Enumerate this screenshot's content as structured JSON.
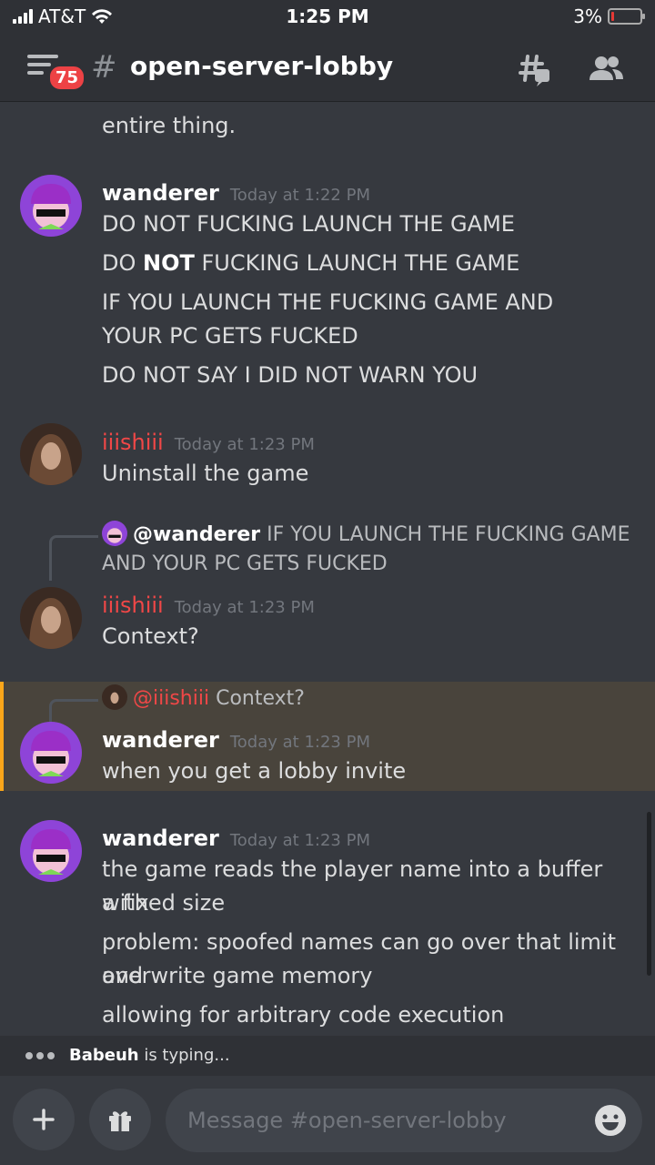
{
  "status": {
    "carrier": "AT&T",
    "time": "1:25 PM",
    "battery": "3%"
  },
  "header": {
    "badge": "75",
    "hash": "#",
    "channel": "open-server-lobby"
  },
  "messages": {
    "partial_line": "entire thing.",
    "g1": {
      "author": "wanderer",
      "time": "Today at 1:22 PM",
      "l1": "DO NOT FUCKING LAUNCH THE GAME",
      "l2_pre": "DO ",
      "l2_bold": "NOT",
      "l2_post": " FUCKING LAUNCH THE GAME",
      "l3a": "IF YOU LAUNCH THE FUCKING GAME AND",
      "l3b": "YOUR PC GETS FUCKED",
      "l4": "DO NOT SAY I DID NOT WARN YOU"
    },
    "g2": {
      "author": "iiishiii",
      "time": "Today at 1:23 PM",
      "l1": "Uninstall the game"
    },
    "g3": {
      "reply_user": "@wanderer",
      "reply_text_a": "IF YOU LAUNCH THE FUCKING GAME",
      "reply_text_b": "AND YOUR PC GETS FUCKED",
      "author": "iiishiii",
      "time": "Today at 1:23 PM",
      "l1": "Context?"
    },
    "g4": {
      "reply_user": "@iiishiii",
      "reply_text": "Context?",
      "author": "wanderer",
      "time": "Today at 1:23 PM",
      "l1": "when you get a lobby invite"
    },
    "g5": {
      "author": "wanderer",
      "time": "Today at 1:23 PM",
      "l1a": "the game reads the player name into a buffer with",
      "l1b": "a fixed size",
      "l2a": "problem: spoofed names can go over that limit and",
      "l2b": "overwrite game memory",
      "l3": "allowing for arbitrary code execution"
    }
  },
  "typing": {
    "user": "Babeuh",
    "suffix": " is typing..."
  },
  "composer": {
    "placeholder": "Message #open-server-lobby"
  },
  "colors": {
    "background": "#36393f",
    "bars": "#2f3136",
    "user_red": "#f04747",
    "mention_highlight": "#49443c",
    "highlight_accent": "#faa61a"
  }
}
